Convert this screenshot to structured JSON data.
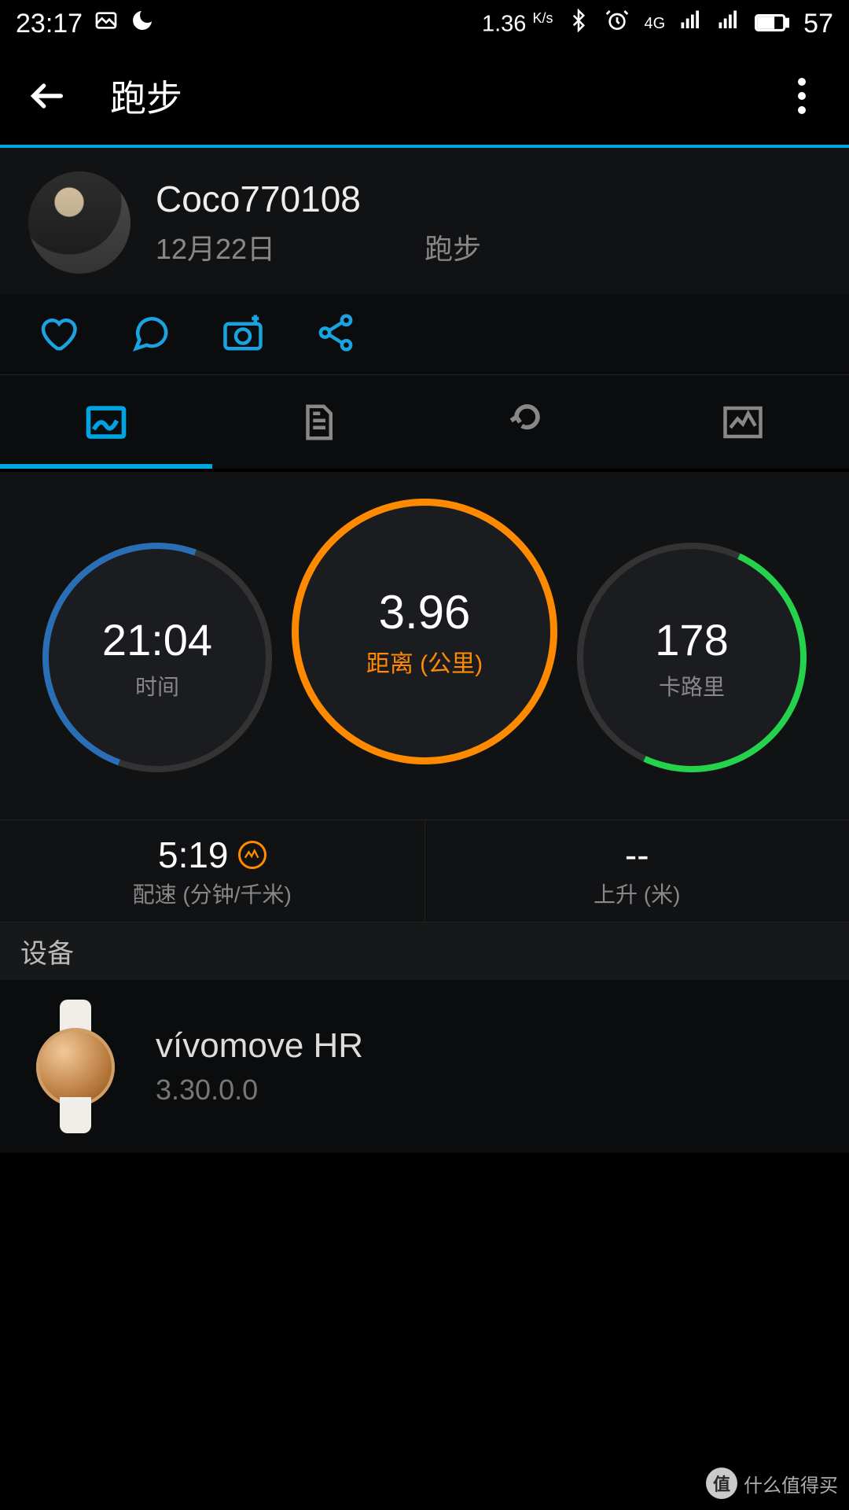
{
  "status": {
    "time": "23:17",
    "net_speed": "1.36",
    "net_unit": "K/s",
    "battery": "57"
  },
  "header": {
    "title": "跑步"
  },
  "user": {
    "name": "Coco770108",
    "date": "12月22日",
    "activity": "跑步"
  },
  "rings": {
    "time": {
      "value": "21:04",
      "label": "时间"
    },
    "distance": {
      "value": "3.96",
      "label": "距离 (公里)"
    },
    "calories": {
      "value": "178",
      "label": "卡路里"
    }
  },
  "metrics": {
    "pace": {
      "value": "5:19",
      "label": "配速 (分钟/千米)"
    },
    "ascent": {
      "value": "--",
      "label": "上升 (米)"
    }
  },
  "sections": {
    "device_header": "设备"
  },
  "device": {
    "name": "vívomove HR",
    "version": "3.30.0.0"
  },
  "watermark": {
    "badge": "值",
    "text": "什么值得买"
  }
}
